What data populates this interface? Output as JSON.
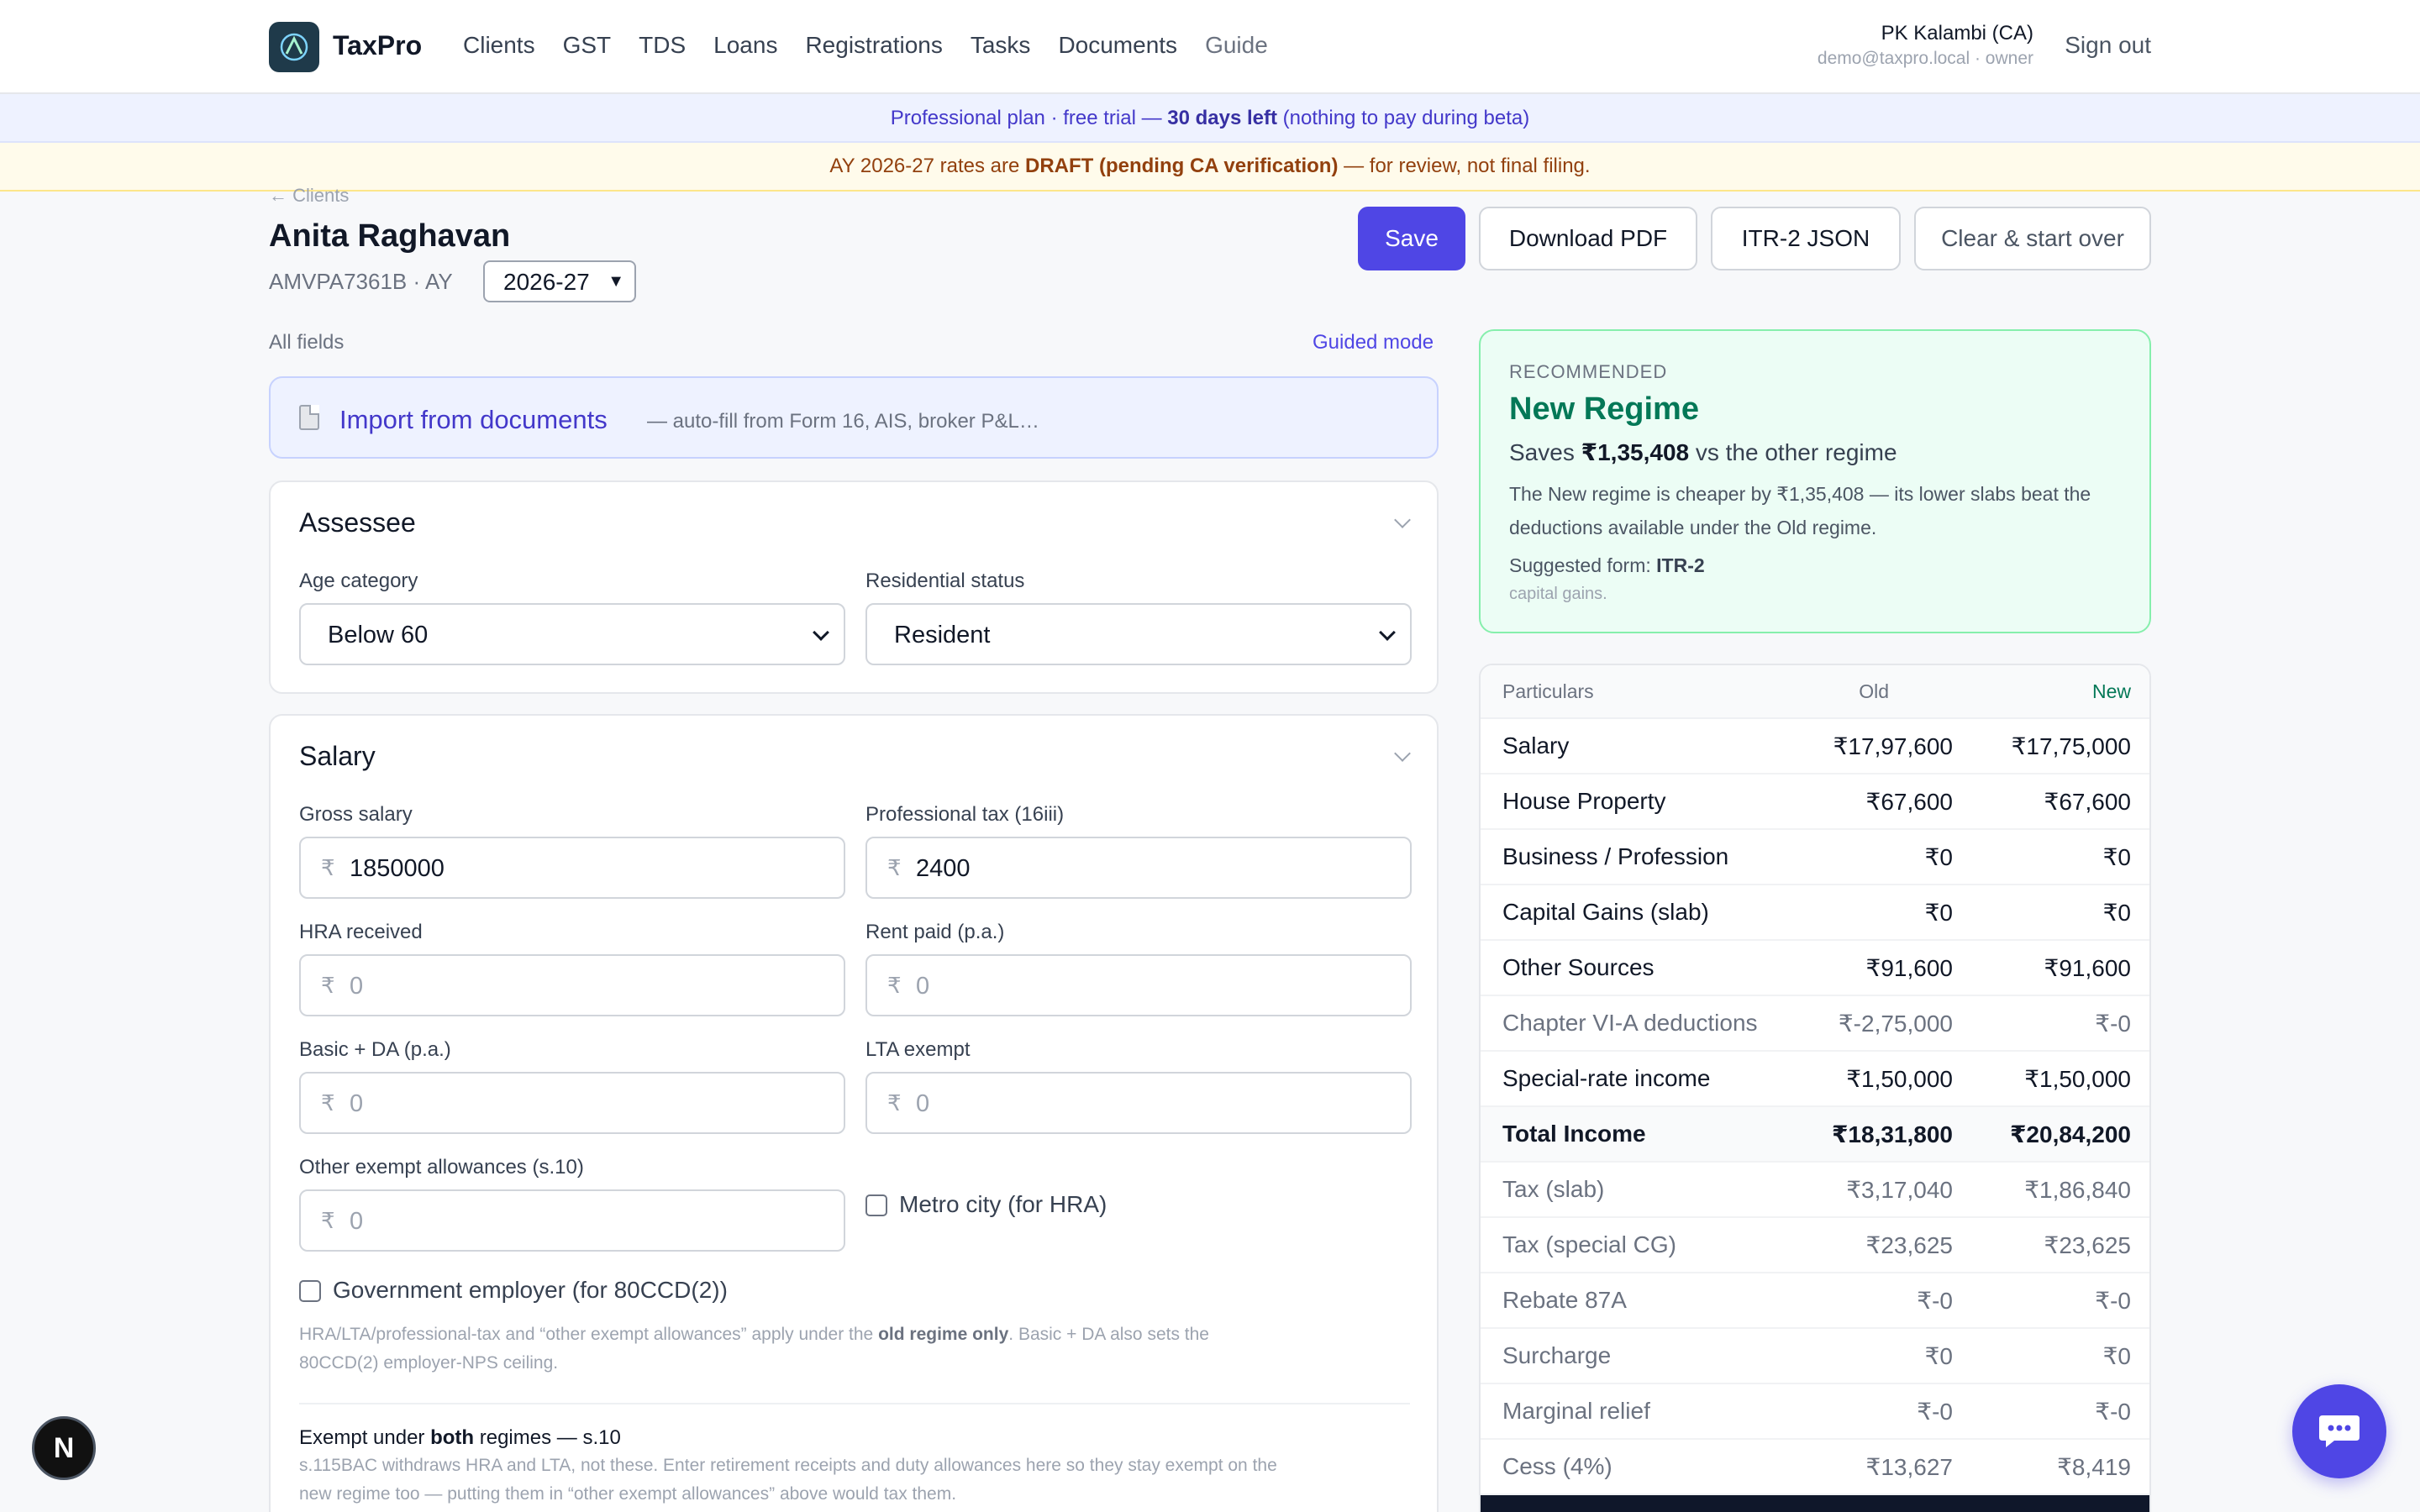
{
  "brand": {
    "name": "TaxPro"
  },
  "nav": {
    "items": [
      "Clients",
      "GST",
      "TDS",
      "Loans",
      "Registrations",
      "Tasks",
      "Documents"
    ],
    "guide": "Guide"
  },
  "user": {
    "name": "PK Kalambi (CA)",
    "email": "demo@taxpro.local · owner",
    "sign_out": "Sign out"
  },
  "banners": {
    "plan_prefix": "Professional plan · free trial — ",
    "plan_days": "30 days left",
    "plan_suffix": " (nothing to pay during beta)",
    "draft_prefix": "AY 2026-27 rates are ",
    "draft_bold": "DRAFT (pending CA verification)",
    "draft_suffix": " — for review, not final filing."
  },
  "header": {
    "back_link": "← Clients",
    "client_name": "Anita Raghavan",
    "pan_line": "AMVPA7361B ·  AY",
    "ay_value": "2026-27"
  },
  "actions": {
    "save": "Save",
    "download_pdf": "Download PDF",
    "itr_json": "ITR-2 JSON",
    "clear": "Clear & start over"
  },
  "mode": {
    "all_fields": "All fields",
    "guided": "Guided mode"
  },
  "import": {
    "title": "Import from documents",
    "sub": "— auto-fill from Form 16, AIS, broker P&L…"
  },
  "assessee": {
    "title": "Assessee",
    "age_label": "Age category",
    "age_value": "Below 60",
    "res_label": "Residential status",
    "res_value": "Resident"
  },
  "salary": {
    "title": "Salary",
    "currency": "₹",
    "gross_label": "Gross salary",
    "gross_value": "1850000",
    "ptax_label": "Professional tax (16iii)",
    "ptax_value": "2400",
    "hra_label": "HRA received",
    "hra_value": "0",
    "rent_label": "Rent paid (p.a.)",
    "rent_value": "0",
    "basic_label": "Basic + DA (p.a.)",
    "basic_value": "0",
    "lta_label": "LTA exempt",
    "lta_value": "0",
    "other_label": "Other exempt allowances (s.10)",
    "other_value": "0",
    "metro_label": "Metro city (for HRA)",
    "govt_label": "Government employer (for 80CCD(2))",
    "note_a": "HRA/LTA/professional-tax and “other exempt allowances” apply under the ",
    "note_b": "old regime only",
    "note_c": ". Basic + DA also sets the",
    "note_d": "80CCD(2) employer-NPS ceiling.",
    "exempt_a": "Exempt under ",
    "exempt_b": "both",
    "exempt_c": " regimes — s.10",
    "exempt_note1": "s.115BAC withdraws HRA and LTA, not these. Enter retirement receipts and duty allowances here so they stay exempt on the",
    "exempt_note2": "new regime too — putting them in “other exempt allowances” above would tax them."
  },
  "recommend": {
    "kicker": "RECOMMENDED",
    "title": "New Regime",
    "saves_a": "Saves ",
    "saves_b": "₹1,35,408",
    "saves_c": " vs the other regime",
    "desc": "The New regime is cheaper by ₹1,35,408 — its lower slabs beat the deductions available under the Old regime.",
    "form_a": "Suggested form: ",
    "form_b": "ITR-2",
    "form_note": "capital gains."
  },
  "table": {
    "headers": [
      "Particulars",
      "Old",
      "New"
    ],
    "rows": [
      [
        "Salary",
        "₹17,97,600",
        "₹17,75,000"
      ],
      [
        "House Property",
        "₹67,600",
        "₹67,600"
      ],
      [
        "Business / Profession",
        "₹0",
        "₹0"
      ],
      [
        "Capital Gains (slab)",
        "₹0",
        "₹0"
      ],
      [
        "Other Sources",
        "₹91,600",
        "₹91,600"
      ],
      [
        "Chapter VI-A deductions",
        "₹-2,75,000",
        "₹-0"
      ],
      [
        "Special-rate income",
        "₹1,50,000",
        "₹1,50,000"
      ],
      [
        "Total Income",
        "₹18,31,800",
        "₹20,84,200"
      ],
      [
        "Tax (slab)",
        "₹3,17,040",
        "₹1,86,840"
      ],
      [
        "Tax (special CG)",
        "₹23,625",
        "₹23,625"
      ],
      [
        "Rebate 87A",
        "₹-0",
        "₹-0"
      ],
      [
        "Surcharge",
        "₹0",
        "₹0"
      ],
      [
        "Marginal relief",
        "₹-0",
        "₹-0"
      ],
      [
        "Cess (4%)",
        "₹13,627",
        "₹8,419"
      ]
    ]
  },
  "fab": {
    "letter": "N"
  },
  "colors": {
    "accent": "#4f46e5",
    "success": "#047857",
    "warning_bg": "#fffbeb"
  }
}
